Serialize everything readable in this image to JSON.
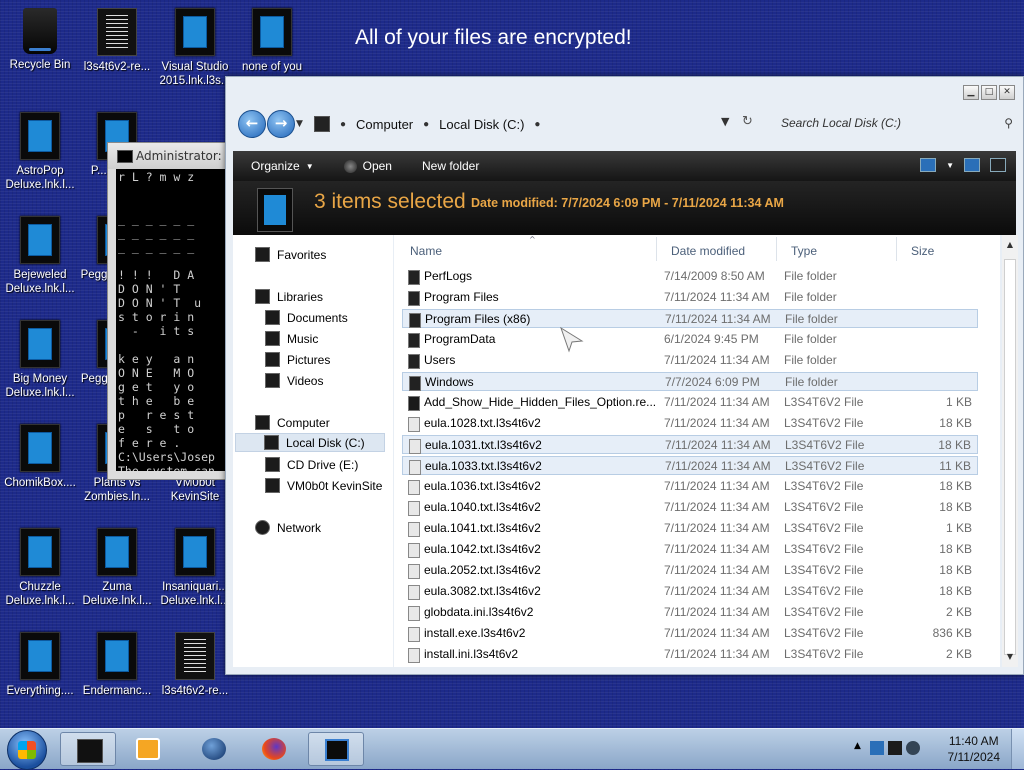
{
  "desktop": {
    "ransom_text": "All of your files are encrypted!",
    "icons": [
      {
        "label": "Recycle Bin",
        "icon": "recycle-bin-icon"
      },
      {
        "label": "l3s4t6v2-re...",
        "icon": "document-icon"
      },
      {
        "label": "Visual Studio 2015.lnk.l3s...",
        "icon": "app-icon"
      },
      {
        "label": "none of you",
        "icon": "app-icon"
      },
      {
        "label": "AstroPop Deluxe.lnk.l...",
        "icon": "app-icon"
      },
      {
        "label": "P... Delu...",
        "icon": "app-icon"
      },
      {
        "label": "Bejeweled Deluxe.lnk.l...",
        "icon": "app-icon"
      },
      {
        "label": "Pegg... Delu...",
        "icon": "app-icon"
      },
      {
        "label": "Big Money Deluxe.lnk.l...",
        "icon": "app-icon"
      },
      {
        "label": "Pegg... of W...",
        "icon": "app-icon"
      },
      {
        "label": "ChomikBox....",
        "icon": "app-icon"
      },
      {
        "label": "Plants vs Zombies.ln...",
        "icon": "app-icon"
      },
      {
        "label": "VM0b0t KevinSite",
        "icon": "app-icon"
      },
      {
        "label": "Chuzzle Deluxe.lnk.l...",
        "icon": "app-icon"
      },
      {
        "label": "Zuma Deluxe.lnk.l...",
        "icon": "app-icon"
      },
      {
        "label": "Insaniquari... Deluxe.lnk.l...",
        "icon": "app-icon"
      },
      {
        "label": "Everything....",
        "icon": "app-icon"
      },
      {
        "label": "Endermanc...",
        "icon": "app-icon"
      },
      {
        "label": "l3s4t6v2-re...",
        "icon": "document-icon"
      }
    ]
  },
  "cmd": {
    "title": "Administrator: C",
    "output": "r L ? m w z\n\n\n_ _ _ _ _ _\n_ _ _ _ _ _\n_ _ _ _ _ _\n\n! ! !   D A\nD O N ' T  \nD O N ' T  u\ns t o r i n\n  -   i t s\n\nk e y   a n\nO N E   M O\ng e t   y o\nt h e   b e\np   r e s t\ne   s   t o\nf e r e .  \nC:\\Users\\Josep\nThe system can\n\nC:\\Users\\Josep"
  },
  "explorer": {
    "breadcrumb": [
      "Computer",
      "Local Disk (C:)"
    ],
    "search_placeholder": "Search Local Disk (C:)",
    "toolbar": {
      "organize": "Organize",
      "open": "Open",
      "new_folder": "New folder"
    },
    "details": {
      "selected_count": "3 items selected",
      "date_modified": "Date modified: 7/7/2024 6:09 PM - 7/11/2024 11:34 AM"
    },
    "nav": {
      "favorites": "Favorites",
      "libraries": "Libraries",
      "lib_items": [
        "Documents",
        "Music",
        "Pictures",
        "Videos"
      ],
      "computer": "Computer",
      "drives": [
        "Local Disk (C:)",
        "CD Drive (E:)",
        "VM0b0t KevinSite"
      ],
      "network": "Network"
    },
    "columns": {
      "name": "Name",
      "date": "Date modified",
      "type": "Type",
      "size": "Size"
    },
    "rows": [
      {
        "name": "PerfLogs",
        "date": "7/14/2009 8:50 AM",
        "type": "File folder",
        "size": "",
        "kind": "folder",
        "selected": false
      },
      {
        "name": "Program Files",
        "date": "7/11/2024 11:34 AM",
        "type": "File folder",
        "size": "",
        "kind": "folder",
        "selected": false
      },
      {
        "name": "Program Files (x86)",
        "date": "7/11/2024 11:34 AM",
        "type": "File folder",
        "size": "",
        "kind": "folder",
        "selected": true
      },
      {
        "name": "ProgramData",
        "date": "6/1/2024 9:45 PM",
        "type": "File folder",
        "size": "",
        "kind": "folder",
        "selected": false
      },
      {
        "name": "Users",
        "date": "7/11/2024 11:34 AM",
        "type": "File folder",
        "size": "",
        "kind": "folder",
        "selected": false
      },
      {
        "name": "Windows",
        "date": "7/7/2024 6:09 PM",
        "type": "File folder",
        "size": "",
        "kind": "folder",
        "selected": true
      },
      {
        "name": "Add_Show_Hide_Hidden_Files_Option.re...",
        "date": "7/11/2024 11:34 AM",
        "type": "L3S4T6V2 File",
        "size": "1 KB",
        "kind": "file",
        "selected": false
      },
      {
        "name": "eula.1028.txt.l3s4t6v2",
        "date": "7/11/2024 11:34 AM",
        "type": "L3S4T6V2 File",
        "size": "18 KB",
        "kind": "doc",
        "selected": false
      },
      {
        "name": "eula.1031.txt.l3s4t6v2",
        "date": "7/11/2024 11:34 AM",
        "type": "L3S4T6V2 File",
        "size": "18 KB",
        "kind": "doc",
        "selected": true
      },
      {
        "name": "eula.1033.txt.l3s4t6v2",
        "date": "7/11/2024 11:34 AM",
        "type": "L3S4T6V2 File",
        "size": "11 KB",
        "kind": "doc",
        "selected": true
      },
      {
        "name": "eula.1036.txt.l3s4t6v2",
        "date": "7/11/2024 11:34 AM",
        "type": "L3S4T6V2 File",
        "size": "18 KB",
        "kind": "doc",
        "selected": false
      },
      {
        "name": "eula.1040.txt.l3s4t6v2",
        "date": "7/11/2024 11:34 AM",
        "type": "L3S4T6V2 File",
        "size": "18 KB",
        "kind": "doc",
        "selected": false
      },
      {
        "name": "eula.1041.txt.l3s4t6v2",
        "date": "7/11/2024 11:34 AM",
        "type": "L3S4T6V2 File",
        "size": "1 KB",
        "kind": "doc",
        "selected": false
      },
      {
        "name": "eula.1042.txt.l3s4t6v2",
        "date": "7/11/2024 11:34 AM",
        "type": "L3S4T6V2 File",
        "size": "18 KB",
        "kind": "doc",
        "selected": false
      },
      {
        "name": "eula.2052.txt.l3s4t6v2",
        "date": "7/11/2024 11:34 AM",
        "type": "L3S4T6V2 File",
        "size": "18 KB",
        "kind": "doc",
        "selected": false
      },
      {
        "name": "eula.3082.txt.l3s4t6v2",
        "date": "7/11/2024 11:34 AM",
        "type": "L3S4T6V2 File",
        "size": "18 KB",
        "kind": "doc",
        "selected": false
      },
      {
        "name": "globdata.ini.l3s4t6v2",
        "date": "7/11/2024 11:34 AM",
        "type": "L3S4T6V2 File",
        "size": "2 KB",
        "kind": "doc",
        "selected": false
      },
      {
        "name": "install.exe.l3s4t6v2",
        "date": "7/11/2024 11:34 AM",
        "type": "L3S4T6V2 File",
        "size": "836 KB",
        "kind": "doc",
        "selected": false
      },
      {
        "name": "install.ini.l3s4t6v2",
        "date": "7/11/2024 11:34 AM",
        "type": "L3S4T6V2 File",
        "size": "2 KB",
        "kind": "doc",
        "selected": false
      }
    ]
  },
  "taskbar": {
    "time": "11:40 AM",
    "date": "7/11/2024",
    "buttons": [
      "explorer-taskbar-icon",
      "media-player-taskbar-icon",
      "globe-taskbar-icon",
      "firefox-taskbar-icon",
      "cmd-taskbar-icon"
    ]
  }
}
